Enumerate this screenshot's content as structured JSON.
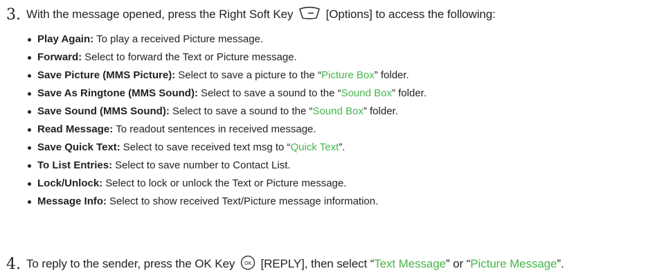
{
  "step3": {
    "number": "3.",
    "text_before": "With the message opened, press the Right Soft Key",
    "key_icon": "right-soft-key-icon",
    "text_after": "[Options] to access the following:"
  },
  "options": [
    {
      "term": "Play Again:",
      "desc_before": "To play a received Picture message.",
      "link": "",
      "desc_after": ""
    },
    {
      "term": "Forward:",
      "desc_before": "Select to forward the Text or Picture message.",
      "link": "",
      "desc_after": ""
    },
    {
      "term": "Save Picture (MMS Picture):",
      "desc_before": "Select to save a picture to the “",
      "link": "Picture Box",
      "desc_after": "” folder."
    },
    {
      "term": "Save As Ringtone (MMS Sound):",
      "desc_before": "Select to save a sound to the “",
      "link": "Sound Box",
      "desc_after": "” folder."
    },
    {
      "term": "Save Sound (MMS Sound):",
      "desc_before": "Select to save a sound to the “",
      "link": "Sound Box",
      "desc_after": "” folder."
    },
    {
      "term": "Read Message:",
      "desc_before": "To readout sentences in received message.",
      "link": "",
      "desc_after": ""
    },
    {
      "term": "Save Quick Text:",
      "desc_before": "Select to save received text msg to “",
      "link": "Quick Text",
      "desc_after": "”."
    },
    {
      "term": "To List Entries:",
      "desc_before": "Select to save number to Contact List.",
      "link": "",
      "desc_after": ""
    },
    {
      "term": "Lock/Unlock:",
      "desc_before": "Select to lock or unlock the Text or Picture message.",
      "link": "",
      "desc_after": ""
    },
    {
      "term": "Message Info:",
      "desc_before": "Select to show received Text/Picture message information.",
      "link": "",
      "desc_after": ""
    }
  ],
  "step4": {
    "number": "4.",
    "text_before": "To reply to the sender, press the OK Key",
    "key_icon": "ok-key-icon",
    "text_mid": "[REPLY], then select “",
    "link1": "Text Message",
    "text_mid2": "” or “",
    "link2": "Picture Message",
    "text_after": "”."
  },
  "colors": {
    "text": "#231f20",
    "link": "#45b649"
  }
}
